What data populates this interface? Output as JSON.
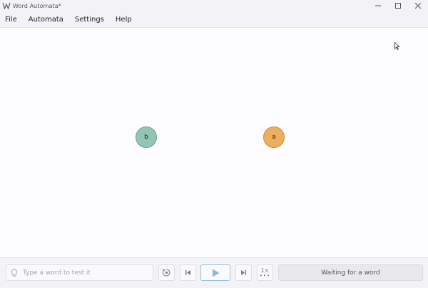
{
  "window": {
    "title": "Word Automata*",
    "icon": "automata-logo-icon",
    "controls": [
      "minimize-icon",
      "maximize-icon",
      "close-icon"
    ]
  },
  "menu": {
    "items": [
      "File",
      "Automata",
      "Settings",
      "Help"
    ]
  },
  "canvas": {
    "states": [
      {
        "label": "b",
        "color": "#92c5b4"
      },
      {
        "label": "a",
        "color": "#efae5d"
      }
    ]
  },
  "toolbar": {
    "word_input": {
      "placeholder": "Type a word to test it",
      "value": "",
      "icon": "lightbulb-icon"
    },
    "reset_icon": "reset-icon",
    "step_back_icon": "step-back-icon",
    "play_icon": "play-icon",
    "step_forward_icon": "step-forward-icon",
    "speed_label": "1×",
    "status_text": "Waiting for a word"
  },
  "colors": {
    "accent": "#9cc0de",
    "play": "#8fb8dc"
  }
}
